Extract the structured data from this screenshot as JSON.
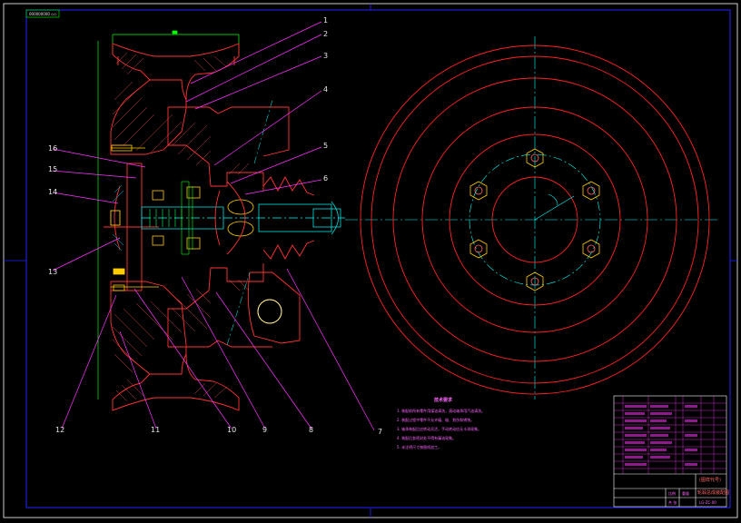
{
  "drawing": {
    "stamp_text": "000000000 ◇◇",
    "part_labels": [
      {
        "id": "1",
        "text": "1"
      },
      {
        "id": "2",
        "text": "2"
      },
      {
        "id": "3",
        "text": "3"
      },
      {
        "id": "4",
        "text": "4"
      },
      {
        "id": "5",
        "text": "5"
      },
      {
        "id": "6",
        "text": "6"
      },
      {
        "id": "7",
        "text": "7"
      },
      {
        "id": "8",
        "text": "8"
      },
      {
        "id": "9",
        "text": "9"
      },
      {
        "id": "10",
        "text": "10"
      },
      {
        "id": "11",
        "text": "11"
      },
      {
        "id": "12",
        "text": "12"
      },
      {
        "id": "13",
        "text": "13"
      },
      {
        "id": "14",
        "text": "14"
      },
      {
        "id": "15",
        "text": "15"
      },
      {
        "id": "16",
        "text": "16"
      }
    ],
    "colors": {
      "background": "#000000",
      "frame": "#2222ff",
      "wheel_outline": "#ff3333",
      "hatch": "#ff5a5a",
      "shaft": "#00e0e0",
      "leader": "#ff33ff",
      "bearing": "#ffcc00",
      "centerline": "#00ffff",
      "hub_frame": "#00ff00",
      "rings": "#ff2222"
    }
  },
  "notes": {
    "title": "技术要求",
    "lines": [
      "1. 装配前所有零件用煤油清洗，滚动轴承用汽油清洗。",
      "2. 装配过程中零件不允许磕、碰、划伤和锈蚀。",
      "3. 轴承装配后应转动灵活，手动转动应无卡滞现象。",
      "4. 装配后各密封处不得有漏油现象。",
      "5. 未注明尺寸按图纸加工。"
    ]
  },
  "title_block": {
    "drawing_title": "轮毂总成装配图",
    "company": "(图样代号)",
    "code": "LG-ZC-00",
    "scale_label": "比例",
    "sheet_label": "共 张",
    "weight_label": "重量"
  }
}
